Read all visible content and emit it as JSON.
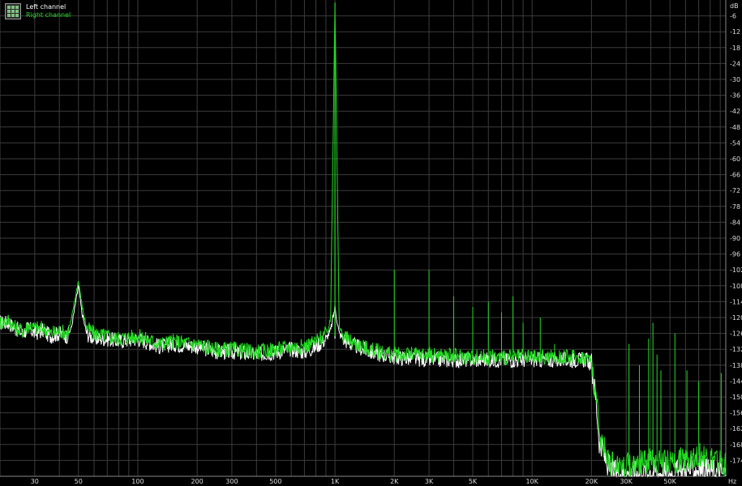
{
  "chart_data": {
    "type": "line",
    "x_scale": "log",
    "x_unit": "Hz",
    "y_unit": "dB",
    "xlim": [
      20,
      96000
    ],
    "ylim": [
      -180,
      0
    ],
    "grid": true,
    "legend_position": "top-left",
    "x_ticks": [
      {
        "value": 30,
        "label": "30"
      },
      {
        "value": 50,
        "label": "50"
      },
      {
        "value": 100,
        "label": "100"
      },
      {
        "value": 200,
        "label": "200"
      },
      {
        "value": 300,
        "label": "300"
      },
      {
        "value": 500,
        "label": "500"
      },
      {
        "value": 1000,
        "label": "1K"
      },
      {
        "value": 2000,
        "label": "2K"
      },
      {
        "value": 3000,
        "label": "3K"
      },
      {
        "value": 5000,
        "label": "5K"
      },
      {
        "value": 10000,
        "label": "10K"
      },
      {
        "value": 20000,
        "label": "20K"
      },
      {
        "value": 30000,
        "label": "30K"
      },
      {
        "value": 50000,
        "label": "50K"
      }
    ],
    "y_ticks": [
      -6,
      -12,
      -18,
      -24,
      -30,
      -36,
      -42,
      -48,
      -54,
      -60,
      -66,
      -72,
      -78,
      -84,
      -90,
      -96,
      -102,
      -108,
      -114,
      -120,
      -126,
      -132,
      -138,
      -144,
      -150,
      -156,
      -162,
      -168,
      -174
    ],
    "series": [
      {
        "name": "Left channel",
        "color": "#ffffff",
        "points": [
          [
            20,
            -122
          ],
          [
            22,
            -122
          ],
          [
            24,
            -124
          ],
          [
            26,
            -126
          ],
          [
            28,
            -124
          ],
          [
            30,
            -126
          ],
          [
            33,
            -125
          ],
          [
            36,
            -127
          ],
          [
            40,
            -126
          ],
          [
            44,
            -127
          ],
          [
            46,
            -124
          ],
          [
            48,
            -116
          ],
          [
            50,
            -108
          ],
          [
            52,
            -118
          ],
          [
            55,
            -126
          ],
          [
            60,
            -128
          ],
          [
            70,
            -128
          ],
          [
            80,
            -129
          ],
          [
            100,
            -128
          ],
          [
            130,
            -131
          ],
          [
            150,
            -130
          ],
          [
            200,
            -131
          ],
          [
            250,
            -133
          ],
          [
            300,
            -133
          ],
          [
            400,
            -134
          ],
          [
            500,
            -133
          ],
          [
            600,
            -132
          ],
          [
            700,
            -133
          ],
          [
            800,
            -131
          ],
          [
            900,
            -128
          ],
          [
            950,
            -125
          ],
          [
            1000,
            -116
          ],
          [
            1050,
            -126
          ],
          [
            1100,
            -128
          ],
          [
            1200,
            -130
          ],
          [
            1500,
            -133
          ],
          [
            2000,
            -135
          ],
          [
            3000,
            -136
          ],
          [
            5000,
            -136
          ],
          [
            10000,
            -136
          ],
          [
            15000,
            -136
          ],
          [
            19000,
            -136
          ],
          [
            20000,
            -138
          ],
          [
            21000,
            -150
          ],
          [
            22000,
            -168
          ],
          [
            25000,
            -178
          ],
          [
            30000,
            -179
          ],
          [
            40000,
            -178
          ],
          [
            50000,
            -179
          ],
          [
            70000,
            -177
          ],
          [
            96000,
            -179
          ]
        ]
      },
      {
        "name": "Right channel",
        "color": "#22dd22",
        "points": [
          [
            20,
            -122
          ],
          [
            22,
            -121
          ],
          [
            24,
            -124
          ],
          [
            26,
            -125
          ],
          [
            28,
            -123
          ],
          [
            30,
            -124
          ],
          [
            33,
            -124
          ],
          [
            36,
            -126
          ],
          [
            40,
            -125
          ],
          [
            44,
            -126
          ],
          [
            46,
            -121
          ],
          [
            48,
            -113
          ],
          [
            50,
            -106
          ],
          [
            52,
            -115
          ],
          [
            55,
            -124
          ],
          [
            60,
            -126
          ],
          [
            70,
            -127
          ],
          [
            80,
            -128
          ],
          [
            100,
            -127
          ],
          [
            130,
            -130
          ],
          [
            150,
            -129
          ],
          [
            200,
            -130
          ],
          [
            250,
            -132
          ],
          [
            300,
            -132
          ],
          [
            400,
            -133
          ],
          [
            500,
            -132
          ],
          [
            600,
            -131
          ],
          [
            700,
            -131
          ],
          [
            800,
            -129
          ],
          [
            900,
            -126
          ],
          [
            950,
            -122
          ],
          [
            1000,
            -1
          ],
          [
            1050,
            -123
          ],
          [
            1100,
            -127
          ],
          [
            1200,
            -129
          ],
          [
            1500,
            -132
          ],
          [
            2000,
            -134
          ],
          [
            3000,
            -134
          ],
          [
            5000,
            -135
          ],
          [
            10000,
            -135
          ],
          [
            15000,
            -135
          ],
          [
            19000,
            -135
          ],
          [
            20000,
            -137
          ],
          [
            21000,
            -148
          ],
          [
            22000,
            -165
          ],
          [
            25000,
            -175
          ],
          [
            30000,
            -176
          ],
          [
            40000,
            -174
          ],
          [
            50000,
            -175
          ],
          [
            70000,
            -172
          ],
          [
            96000,
            -176
          ]
        ]
      }
    ],
    "annotations_spikes": {
      "series": "Right channel",
      "frequencies": [
        2000,
        3000,
        4000,
        5000,
        6000,
        7000,
        8000,
        9000,
        11000,
        13000,
        31000,
        35000,
        39000,
        41000,
        43000,
        45000,
        53000,
        61000,
        70000,
        91000
      ],
      "peaks_db": [
        -102,
        -102,
        -112,
        -116,
        -114,
        -118,
        -112,
        -122,
        -120,
        -130,
        -130,
        -138,
        -128,
        -122,
        -134,
        -140,
        -126,
        -140,
        -144,
        -141
      ]
    }
  },
  "legend": {
    "left_label": "Left channel",
    "right_label": "Right channel"
  },
  "axis": {
    "y_unit_label": "dB",
    "x_unit_label": "Hz"
  }
}
